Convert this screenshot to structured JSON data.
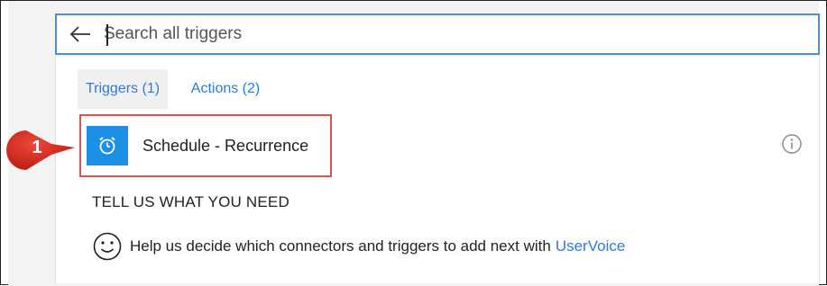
{
  "search": {
    "placeholder": "Search all triggers",
    "value": ""
  },
  "tabs": [
    {
      "label": "Triggers (1)",
      "selected": true
    },
    {
      "label": "Actions (2)",
      "selected": false
    }
  ],
  "trigger": {
    "label": "Schedule - Recurrence",
    "icon": "alarm-clock-icon"
  },
  "help_section": {
    "title": "TELL US WHAT YOU NEED",
    "text": "Help us decide which connectors and triggers to add next with",
    "link": "UserVoice"
  },
  "callout": {
    "number": "1"
  },
  "colors": {
    "accent": "#2f7ad6",
    "search_border": "#4a90d9",
    "trigger_icon_bg": "#1d8fe5",
    "highlight_border": "#d9534f",
    "callout_red": "#d9281e"
  }
}
